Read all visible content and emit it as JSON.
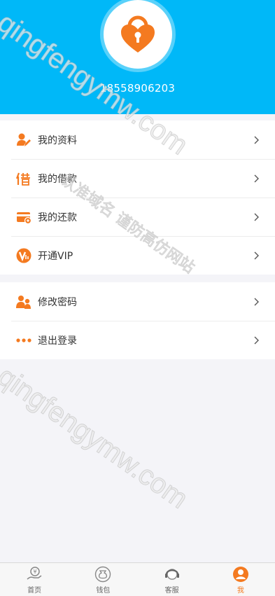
{
  "profile": {
    "phone": "18558906203"
  },
  "menu_group1": [
    {
      "label": "我的资料",
      "icon": "user-edit-icon"
    },
    {
      "label": "我的借款",
      "icon": "borrow-icon"
    },
    {
      "label": "我的还款",
      "icon": "repay-card-icon"
    },
    {
      "label": "开通VIP",
      "icon": "vip-icon"
    }
  ],
  "menu_group2": [
    {
      "label": "修改密码",
      "icon": "users-icon"
    },
    {
      "label": "退出登录",
      "icon": "more-dots-icon"
    }
  ],
  "tabs": [
    {
      "label": "首页",
      "icon": "home-money-icon"
    },
    {
      "label": "钱包",
      "icon": "wallet-bag-icon"
    },
    {
      "label": "客服",
      "icon": "customer-service-icon"
    },
    {
      "label": "我",
      "icon": "me-user-icon",
      "active": true
    }
  ],
  "watermark": {
    "text1": "qingfengymw.com",
    "text2": "qingfengymw.com",
    "text3": "认准域名 谨防高仿网站"
  },
  "colors": {
    "header": "#00b8f8",
    "accent": "#f47a20"
  }
}
